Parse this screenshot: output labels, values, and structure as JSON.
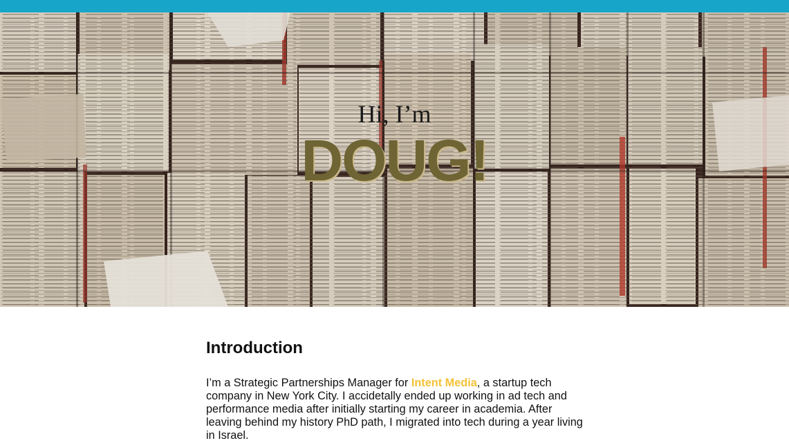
{
  "colors": {
    "top_bar": "#17a6c9",
    "name_text": "#6e6434",
    "link": "#f3c237"
  },
  "hero": {
    "background_image": "book-pages-background",
    "greeting": "Hi, I’m",
    "name": "DOUG!"
  },
  "intro": {
    "title": "Introduction",
    "text_before_link": "I’m a Strategic Partnerships Manager for ",
    "link_text": "Intent Media",
    "text_after_link": ", a startup tech company in New York City. I accidetally ended up working in ad tech and performance media after initially starting my career in academia. After leaving behind my history PhD path, I migrated into tech during a year living in Israel."
  }
}
